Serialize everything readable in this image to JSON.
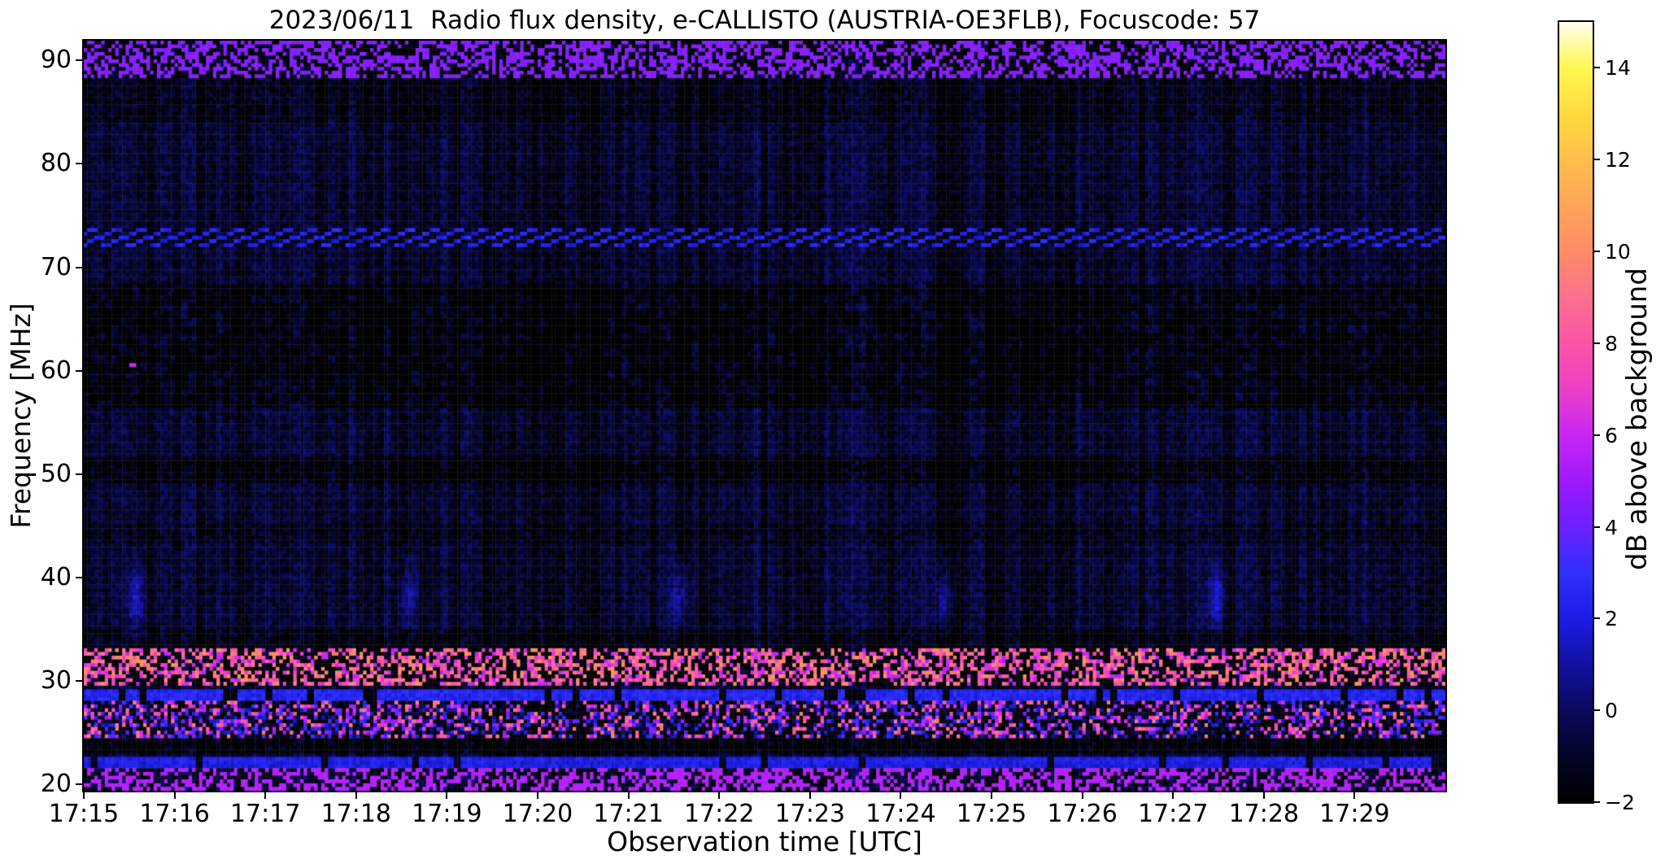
{
  "figure": {
    "title": "2023/06/11  Radio flux density, e-CALLISTO (AUSTRIA-OE3FLB), Focuscode: 57",
    "xlabel": "Observation time [UTC]",
    "ylabel": "Frequency [MHz]",
    "colorbar_label": "dB above background"
  },
  "chart_data": {
    "type": "heatmap",
    "title": "2023/06/11  Radio flux density, e-CALLISTO (AUSTRIA-OE3FLB), Focuscode: 57",
    "xlabel": "Observation time [UTC]",
    "ylabel": "Frequency [MHz]",
    "x_range_minutes_after_1715": [
      0,
      15
    ],
    "x_ticks": [
      {
        "minute": 0,
        "label": "17:15"
      },
      {
        "minute": 1,
        "label": "17:16"
      },
      {
        "minute": 2,
        "label": "17:17"
      },
      {
        "minute": 3,
        "label": "17:18"
      },
      {
        "minute": 4,
        "label": "17:19"
      },
      {
        "minute": 5,
        "label": "17:20"
      },
      {
        "minute": 6,
        "label": "17:21"
      },
      {
        "minute": 7,
        "label": "17:22"
      },
      {
        "minute": 8,
        "label": "17:23"
      },
      {
        "minute": 9,
        "label": "17:24"
      },
      {
        "minute": 10,
        "label": "17:25"
      },
      {
        "minute": 11,
        "label": "17:26"
      },
      {
        "minute": 12,
        "label": "17:27"
      },
      {
        "minute": 13,
        "label": "17:28"
      },
      {
        "minute": 14,
        "label": "17:29"
      }
    ],
    "y_range_mhz": [
      19.4,
      91.9
    ],
    "y_ticks": [
      {
        "value": 20,
        "label": "20"
      },
      {
        "value": 30,
        "label": "30"
      },
      {
        "value": 40,
        "label": "40"
      },
      {
        "value": 50,
        "label": "50"
      },
      {
        "value": 60,
        "label": "60"
      },
      {
        "value": 70,
        "label": "70"
      },
      {
        "value": 80,
        "label": "80"
      },
      {
        "value": 90,
        "label": "90"
      }
    ],
    "colorbar": {
      "label": "dB above background",
      "range_db": [
        -2,
        15
      ],
      "ticks": [
        {
          "value": 14,
          "label": "14"
        },
        {
          "value": 12,
          "label": "12"
        },
        {
          "value": 10,
          "label": "10"
        },
        {
          "value": 8,
          "label": "8"
        },
        {
          "value": 6,
          "label": "6"
        },
        {
          "value": 4,
          "label": "4"
        },
        {
          "value": 2,
          "label": "2"
        },
        {
          "value": 0,
          "label": "0"
        },
        {
          "value": -2,
          "label": "−2"
        }
      ],
      "colormap_name": "gnuplot2-like (black-blue-violet-magenta-pink-orange-yellow-white)",
      "stops": [
        [
          -2,
          0,
          0,
          0
        ],
        [
          -1,
          4,
          4,
          40
        ],
        [
          0,
          10,
          10,
          92
        ],
        [
          1,
          17,
          17,
          160
        ],
        [
          2,
          28,
          28,
          230
        ],
        [
          3,
          48,
          48,
          255
        ],
        [
          4,
          108,
          32,
          255
        ],
        [
          5,
          158,
          25,
          253
        ],
        [
          6,
          200,
          38,
          244
        ],
        [
          7,
          236,
          64,
          198
        ],
        [
          8,
          250,
          84,
          168
        ],
        [
          9,
          253,
          112,
          142
        ],
        [
          10,
          253,
          140,
          102
        ],
        [
          11,
          254,
          165,
          88
        ],
        [
          12,
          255,
          190,
          76
        ],
        [
          13,
          255,
          218,
          62
        ],
        [
          14,
          255,
          247,
          80
        ],
        [
          15,
          255,
          255,
          240
        ]
      ]
    },
    "background_level_db": 0.5,
    "background_note": "quiet navy-blue noise floor (~0 to 1.5 dB) with fine vertical striping, no solar burst",
    "features": [
      {
        "f_lo": 88.3,
        "f_hi": 91.9,
        "kind": "contrast_mottle",
        "amp": 2.2,
        "speck_p": 0.012,
        "speck_db": 4.5,
        "note": "high-contrast noise band with sparse magenta specks"
      },
      {
        "f_lo": 84.0,
        "f_hi": 88.3,
        "kind": "faint_mottle",
        "amp": 0.9
      },
      {
        "f_lo": 71.8,
        "f_hi": 73.6,
        "kind": "diagonal_interference",
        "bright_db": 2.2,
        "dark_db": -1.5,
        "note": "slanted bright/dark dashes across full duration"
      },
      {
        "f_lo": 56.5,
        "f_hi": 68.5,
        "kind": "block_mottle",
        "amp": 1.9,
        "note": "blocky mottled interference band"
      },
      {
        "f_lo": 49.3,
        "f_hi": 51.6,
        "kind": "dark_dotted",
        "amp": 1.6
      },
      {
        "f_lo": 43.5,
        "f_hi": 45.0,
        "kind": "faint_mottle",
        "amp": 0.8
      },
      {
        "f_lo": 33.0,
        "f_hi": 35.0,
        "kind": "faint_mottle",
        "amp": 1.2
      },
      {
        "f_lo": 29.4,
        "f_hi": 33.2,
        "kind": "speckle_mottle",
        "amp": 2.4,
        "speck_p": 0.006,
        "speck_db_min": 8,
        "speck_db_max": 13,
        "note": "mottled band with rare orange dots"
      },
      {
        "f_lo": 28.1,
        "f_hi": 29.3,
        "kind": "dash_stripe",
        "duty": 0.38,
        "bright_db": 2.4,
        "dark_db": -1.7,
        "seg": 2,
        "seed": 7001,
        "note": "black stripe broken by bright blue dashes"
      },
      {
        "f_lo": 24.3,
        "f_hi": 28.1,
        "kind": "rfi_speckle",
        "amp": 2.6,
        "speck_p": 0.013,
        "speck_db_min": 4.5,
        "speck_db_max": 15,
        "burst_center_min": 10.3,
        "burst_width_min": 1.8,
        "burst_gain": 1.6,
        "note": "shortwave RFI band: pink/orange/yellow/white pixels, densest 17:24-17:26"
      },
      {
        "f_lo": 23.0,
        "f_hi": 24.3,
        "kind": "dark_mottle",
        "amp": 1.8
      },
      {
        "f_lo": 21.7,
        "f_hi": 22.5,
        "kind": "dash_stripe",
        "duty": 0.45,
        "bright_db": 2.0,
        "dark_db": -1.2,
        "seg": 2,
        "seed": 7501
      },
      {
        "f_lo": 19.4,
        "f_hi": 21.7,
        "kind": "bright_mottle",
        "amp": 1.6,
        "lift_db": 0.55,
        "speck_p": 0.004,
        "speck_db": 5.5,
        "note": "brighter blue bottom edge band"
      }
    ],
    "vertical_streaks": {
      "times_min": [
        0.58,
        3.57,
        6.56,
        9.47,
        12.48
      ],
      "f_center_mhz": 38,
      "db": 2.4,
      "note": "faint periodic blue enhancements near 36-40 MHz"
    },
    "point_events": [
      {
        "t_min": 0.55,
        "f_mhz": 60.5,
        "db": 6,
        "note": "single magenta pixel"
      }
    ]
  }
}
